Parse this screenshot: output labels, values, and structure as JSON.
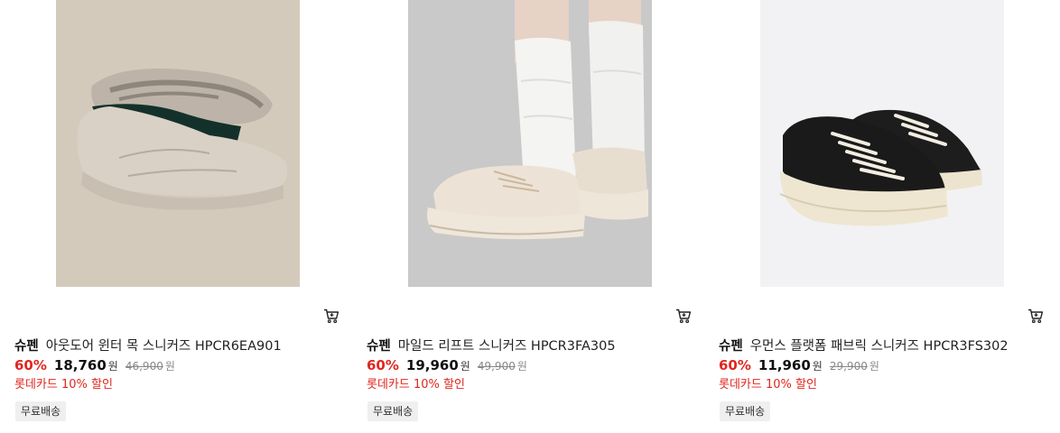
{
  "products": [
    {
      "brand": "슈펜",
      "name": "아웃도어 윈터 목 스니커즈 HPCR6EA901",
      "discount": "60%",
      "price": "18,760",
      "currency": "원",
      "original_price": "46,900",
      "promo": "롯데카드 10% 할인",
      "badge": "무료배송",
      "image": "beige suede slip-on sneakers"
    },
    {
      "brand": "슈펜",
      "name": "마일드 리프트 스니커즈 HPCR3FA305",
      "discount": "60%",
      "price": "19,960",
      "currency": "원",
      "original_price": "49,900",
      "promo": "롯데카드 10% 할인",
      "badge": "무료배송",
      "image": "cream platform lace-up sneakers with white socks"
    },
    {
      "brand": "슈펜",
      "name": "우먼스 플랫폼 패브릭 스니커즈 HPCR3FS302",
      "discount": "60%",
      "price": "11,960",
      "currency": "원",
      "original_price": "29,900",
      "promo": "롯데카드 10% 할인",
      "badge": "무료배송",
      "image": "black canvas platform sneakers"
    }
  ],
  "icons": {
    "cart": "cart-icon"
  },
  "colors": {
    "accent_red": "#e0271f",
    "badge_bg": "#efefef"
  }
}
